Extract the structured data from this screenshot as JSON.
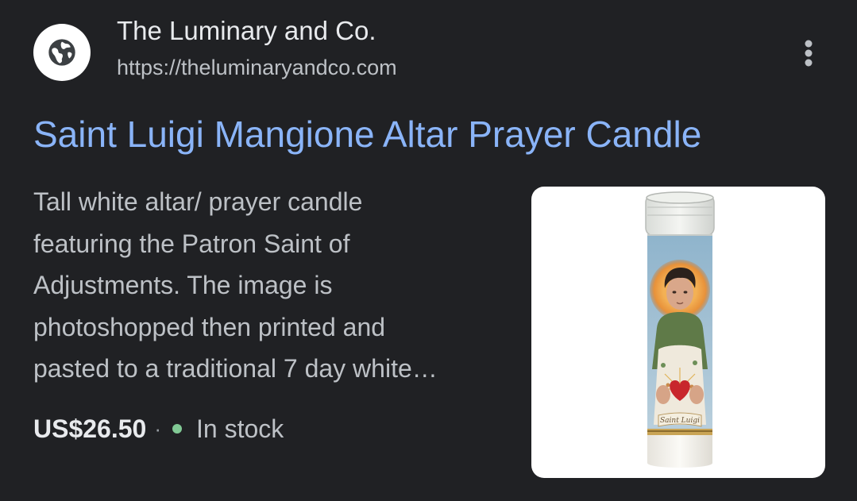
{
  "source": {
    "site_name": "The Luminary and Co.",
    "url": "https://theluminaryandco.com",
    "favicon_icon": "globe-icon",
    "more_icon": "more-vert-icon"
  },
  "result": {
    "title": "Saint Luigi Mangione Altar Prayer Candle",
    "snippet_lines": [
      "Tall white altar/ prayer candle",
      "featuring the Patron Saint of",
      "Adjustments. The image is",
      "photoshopped then printed and",
      "pasted to a traditional 7 day white…"
    ],
    "price": "US$26.50",
    "separator": "·",
    "stock_status": "In stock"
  },
  "thumbnail": {
    "label_script": "Saint Luigi"
  },
  "colors": {
    "background": "#202124",
    "title_link": "#8ab4f8",
    "text_primary": "#e8eaed",
    "text_secondary": "#bdc1c6",
    "in_stock_dot": "#81c995"
  }
}
